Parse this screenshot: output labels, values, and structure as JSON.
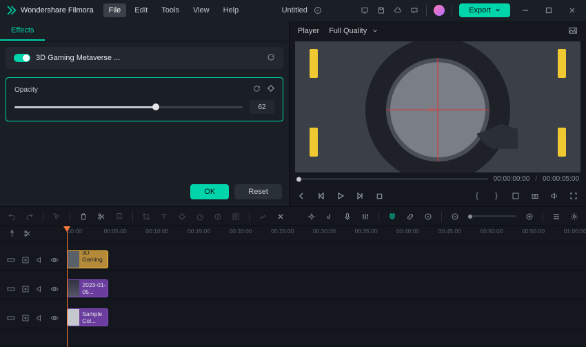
{
  "titlebar": {
    "app_name": "Wondershare Filmora",
    "menus": [
      "File",
      "Edit",
      "Tools",
      "View",
      "Help"
    ],
    "active_menu_index": 0,
    "doc_title": "Untitled",
    "export_label": "Export"
  },
  "effects_panel": {
    "tab_label": "Effects",
    "effect_name": "3D Gaming Metaverse ...",
    "param_label": "Opacity",
    "opacity_value": "62",
    "ok_label": "OK",
    "reset_label": "Reset"
  },
  "player": {
    "header_label": "Player",
    "quality_label": "Full Quality",
    "scope_text": "0X",
    "current_time": "00:00:00:00",
    "total_time": "00:00:05:00"
  },
  "ruler": {
    "labels": [
      "00:00",
      "00:05:00",
      "00:10:00",
      "00:15:00",
      "00:20:00",
      "00:25:00",
      "00:30:00",
      "00:35:00",
      "00:40:00",
      "00:45:00",
      "00:50:00",
      "00:55:00",
      "01:00:00"
    ]
  },
  "tracks": {
    "fx_clip_label": "3D Gaming ...",
    "vid_clip_label": "2023-01-05...",
    "color_clip_label": "Sample Col..."
  }
}
